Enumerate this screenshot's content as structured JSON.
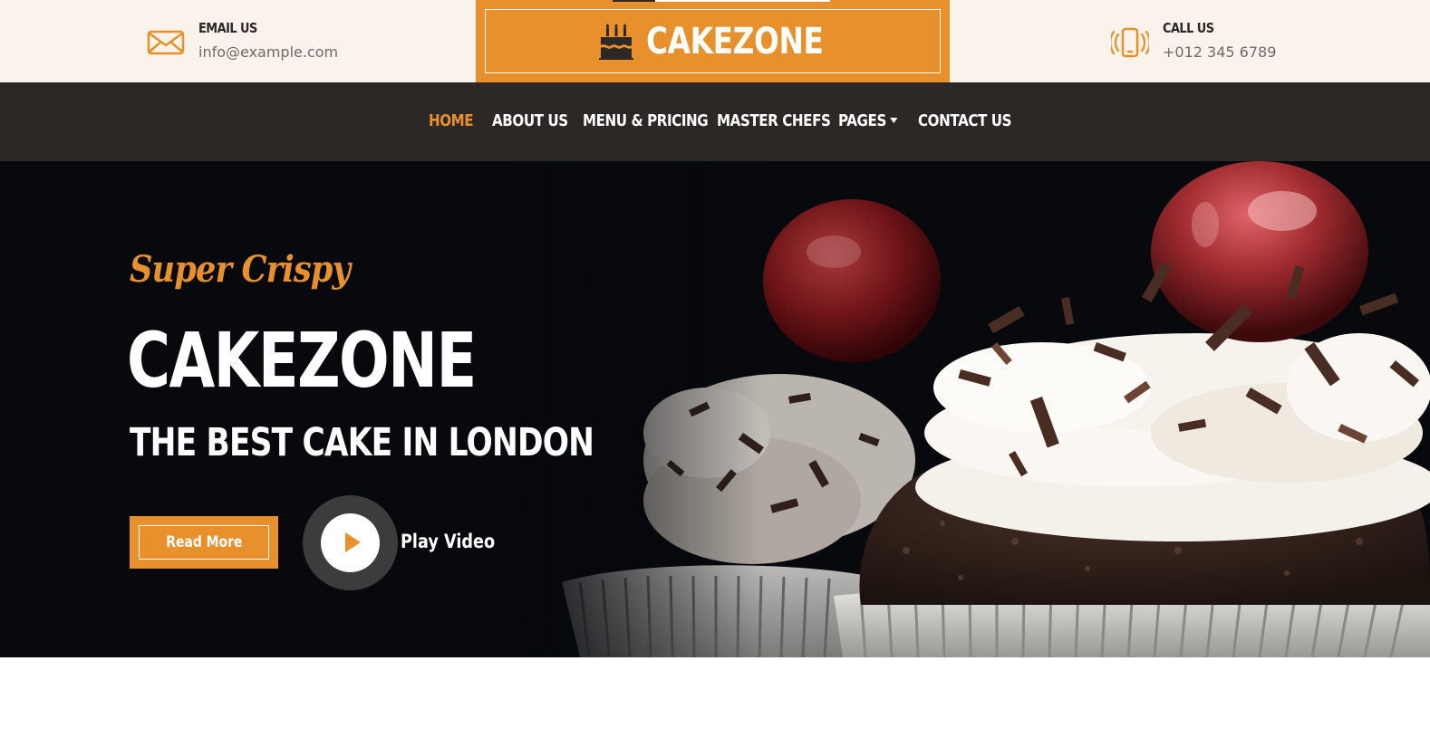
{
  "header": {
    "email": {
      "label": "EMAIL US",
      "value": "info@example.com",
      "icon": "envelope-icon"
    },
    "phone": {
      "label": "CALL US",
      "value": "+012 345 6789",
      "icon": "phone-vibrate-icon"
    },
    "logo": {
      "text": "CAKEZONE",
      "icon": "birthday-cake-icon"
    }
  },
  "nav": {
    "items": [
      {
        "label": "HOME",
        "active": true
      },
      {
        "label": "ABOUT US"
      },
      {
        "label": "MENU & PRICING"
      },
      {
        "label": "MASTER CHEFS"
      },
      {
        "label": "PAGES",
        "dropdown": true
      },
      {
        "label": "CONTACT US"
      }
    ]
  },
  "hero": {
    "tagline": "Super Crispy",
    "title": "CAKEZONE",
    "subtitle": "THE BEST CAKE IN LONDON",
    "read_more": "Read More",
    "play_video": "Play Video",
    "image": "chocolate-cupcakes-with-cream-and-cherries"
  },
  "colors": {
    "accent": "#e8902c",
    "dark": "#2b2825",
    "topbar_bg": "#faf3eb",
    "hero_bg": "#07090d"
  }
}
